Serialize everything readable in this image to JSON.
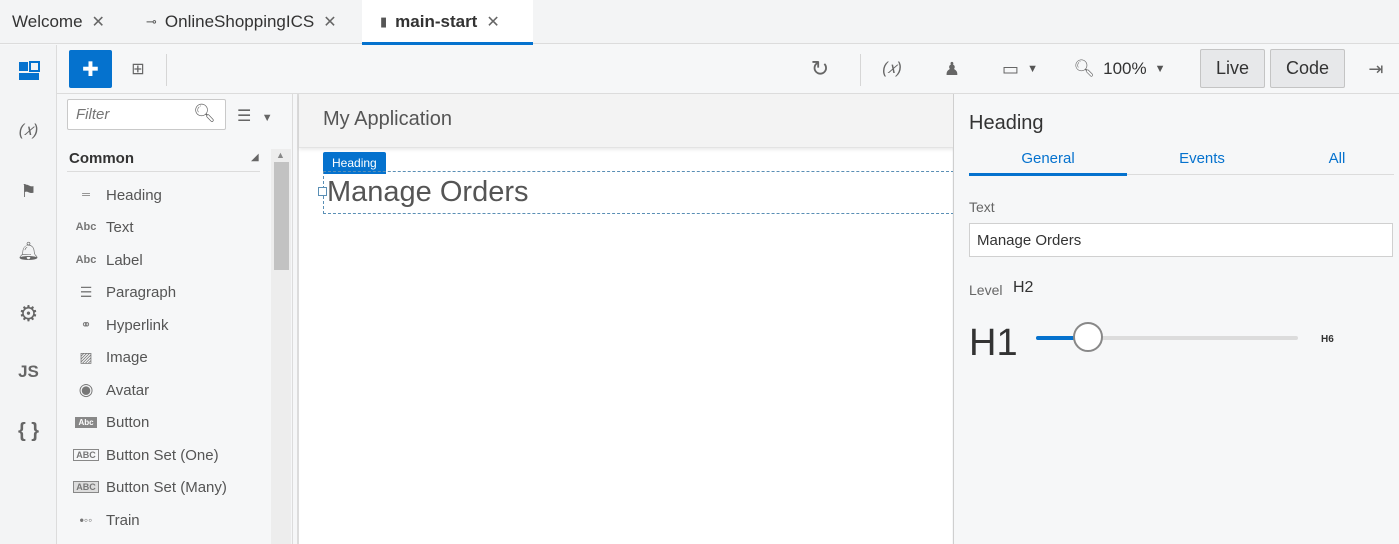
{
  "tabs": [
    {
      "label": "Welcome",
      "icon": "none"
    },
    {
      "label": "OnlineShoppingICS",
      "icon": "service-icon"
    },
    {
      "label": "main-start",
      "icon": "file-icon"
    }
  ],
  "toolbar": {
    "zoom": "100%",
    "live_label": "Live",
    "code_label": "Code"
  },
  "palette": {
    "filter_placeholder": "Filter",
    "section": "Common",
    "components": [
      {
        "label": "Heading",
        "icon": "heading-icon"
      },
      {
        "label": "Text",
        "icon": "text-icon"
      },
      {
        "label": "Label",
        "icon": "label-icon"
      },
      {
        "label": "Paragraph",
        "icon": "paragraph-icon"
      },
      {
        "label": "Hyperlink",
        "icon": "hyperlink-icon"
      },
      {
        "label": "Image",
        "icon": "image-icon"
      },
      {
        "label": "Avatar",
        "icon": "avatar-icon"
      },
      {
        "label": "Button",
        "icon": "button-icon"
      },
      {
        "label": "Button Set (One)",
        "icon": "button-set-one-icon"
      },
      {
        "label": "Button Set (Many)",
        "icon": "button-set-many-icon"
      },
      {
        "label": "Train",
        "icon": "train-icon"
      }
    ]
  },
  "canvas": {
    "app_title": "My Application",
    "selected_badge": "Heading",
    "heading_text": "Manage Orders"
  },
  "properties": {
    "title": "Heading",
    "tabs": [
      "General",
      "Events",
      "All"
    ],
    "text_label": "Text",
    "text_value": "Manage Orders",
    "level_label": "Level",
    "level_value": "H2",
    "min_label": "H1",
    "max_label": "H6",
    "level_slider": {
      "min": 1,
      "max": 6,
      "value": 2
    }
  },
  "colors": {
    "accent": "#0572ce"
  }
}
